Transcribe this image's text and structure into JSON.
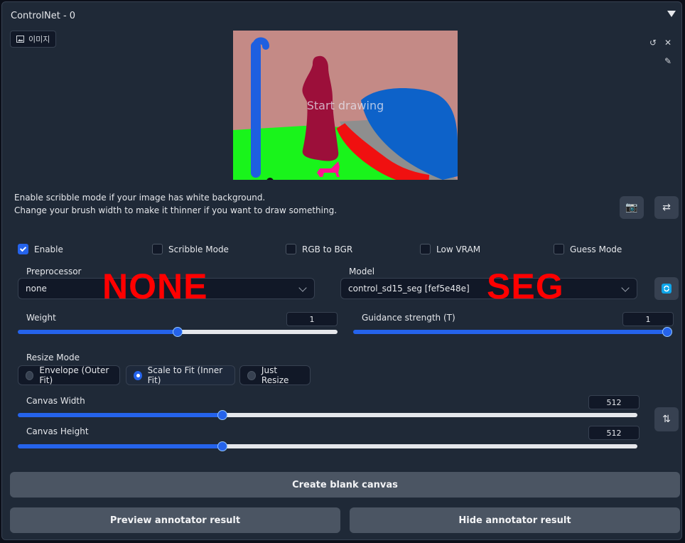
{
  "header": {
    "title": "ControlNet - 0"
  },
  "image_tab": {
    "label": "이미지"
  },
  "canvas": {
    "hint": "Start drawing"
  },
  "info": {
    "line1": "Enable scribble mode if your image has white background.",
    "line2": "Change your brush width to make it thinner if you want to draw something."
  },
  "checkboxes": [
    {
      "label": "Enable",
      "checked": true
    },
    {
      "label": "Scribble Mode",
      "checked": false
    },
    {
      "label": "RGB to BGR",
      "checked": false
    },
    {
      "label": "Low VRAM",
      "checked": false
    },
    {
      "label": "Guess Mode",
      "checked": false
    }
  ],
  "preprocessor": {
    "label": "Preprocessor",
    "value": "none"
  },
  "model": {
    "label": "Model",
    "value": "control_sd15_seg [fef5e48e]"
  },
  "overlays": {
    "left": "NONE",
    "right": "SEG"
  },
  "weight": {
    "label": "Weight",
    "value": "1",
    "fraction": 0.5
  },
  "guidance": {
    "label": "Guidance strength (T)",
    "value": "1",
    "fraction": 1.0
  },
  "resize": {
    "label": "Resize Mode",
    "options": [
      "Envelope (Outer Fit)",
      "Scale to Fit (Inner Fit)",
      "Just Resize"
    ],
    "selected": 1
  },
  "canvas_width": {
    "label": "Canvas Width",
    "value": "512",
    "fraction": 0.33
  },
  "canvas_height": {
    "label": "Canvas Height",
    "value": "512",
    "fraction": 0.33
  },
  "buttons": {
    "create": "Create blank canvas",
    "preview": "Preview annotator result",
    "hide": "Hide annotator result"
  },
  "colors": {
    "accent": "#2563eb",
    "panel": "#1f2937",
    "button": "#4b5563"
  }
}
